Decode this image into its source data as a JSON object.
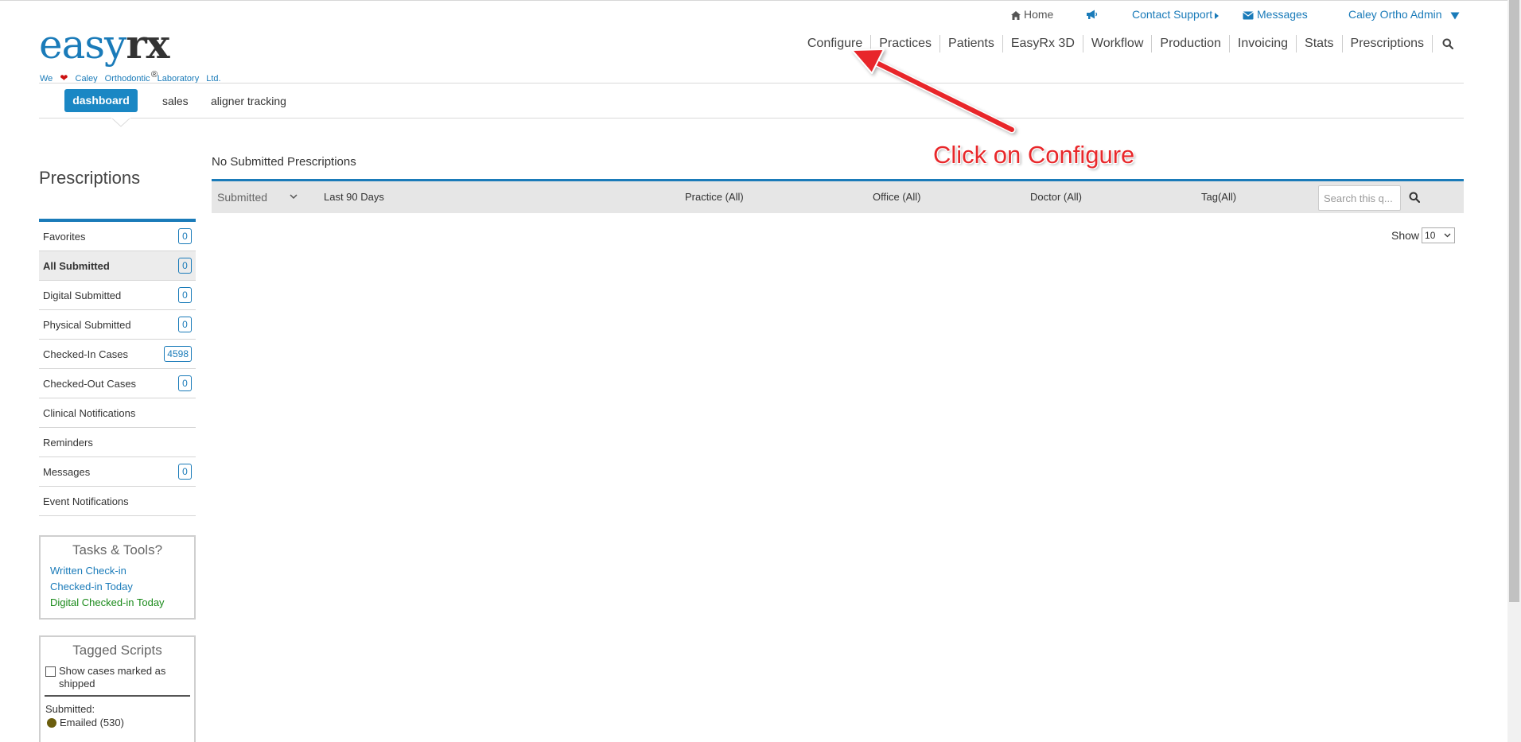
{
  "header": {
    "utility": {
      "home": "Home",
      "contact_support": "Contact Support",
      "messages": "Messages",
      "user": "Caley Ortho Admin"
    },
    "logo": {
      "easy": "easy",
      "rx": "rx",
      "reg": "®"
    },
    "tagline": {
      "we": "We",
      "lab": "Caley Orthodontic Laboratory Ltd."
    },
    "nav": [
      "Configure",
      "Practices",
      "Patients",
      "EasyRx 3D",
      "Workflow",
      "Production",
      "Invoicing",
      "Stats",
      "Prescriptions"
    ]
  },
  "subnav": {
    "dashboard": "dashboard",
    "sales": "sales",
    "aligner_tracking": "aligner tracking"
  },
  "sidebar": {
    "title": "Prescriptions",
    "items": [
      {
        "label": "Favorites",
        "count": "0"
      },
      {
        "label": "All Submitted",
        "count": "0"
      },
      {
        "label": "Digital Submitted",
        "count": "0"
      },
      {
        "label": "Physical Submitted",
        "count": "0"
      },
      {
        "label": "Checked-In Cases",
        "count": "4598"
      },
      {
        "label": "Checked-Out Cases",
        "count": "0"
      },
      {
        "label": "Clinical Notifications",
        "count": ""
      },
      {
        "label": "Reminders",
        "count": ""
      },
      {
        "label": "Messages",
        "count": "0"
      },
      {
        "label": "Event Notifications",
        "count": ""
      }
    ],
    "tasks": {
      "title": "Tasks & Tools?",
      "links": [
        "Written Check-in",
        "Checked-in Today",
        "Digital Checked-in Today"
      ]
    },
    "tagged": {
      "title": "Tagged Scripts",
      "checkbox_label": "Show cases marked as shipped",
      "submitted_label": "Submitted:",
      "emailed": "Emailed (530)"
    }
  },
  "main": {
    "title": "No Submitted Prescriptions",
    "filters": {
      "status": "Submitted",
      "range": "Last 90 Days",
      "practice": "Practice (All)",
      "office": "Office (All)",
      "doctor": "Doctor (All)",
      "tag": "Tag(All)",
      "search_placeholder": "Search this q..."
    },
    "show_label": "Show",
    "show_value": "10"
  },
  "annotation": {
    "text": "Click on Configure"
  },
  "colors": {
    "accent": "#1a7bb9",
    "annotation": "#e8282b",
    "heart": "#cc1010"
  }
}
